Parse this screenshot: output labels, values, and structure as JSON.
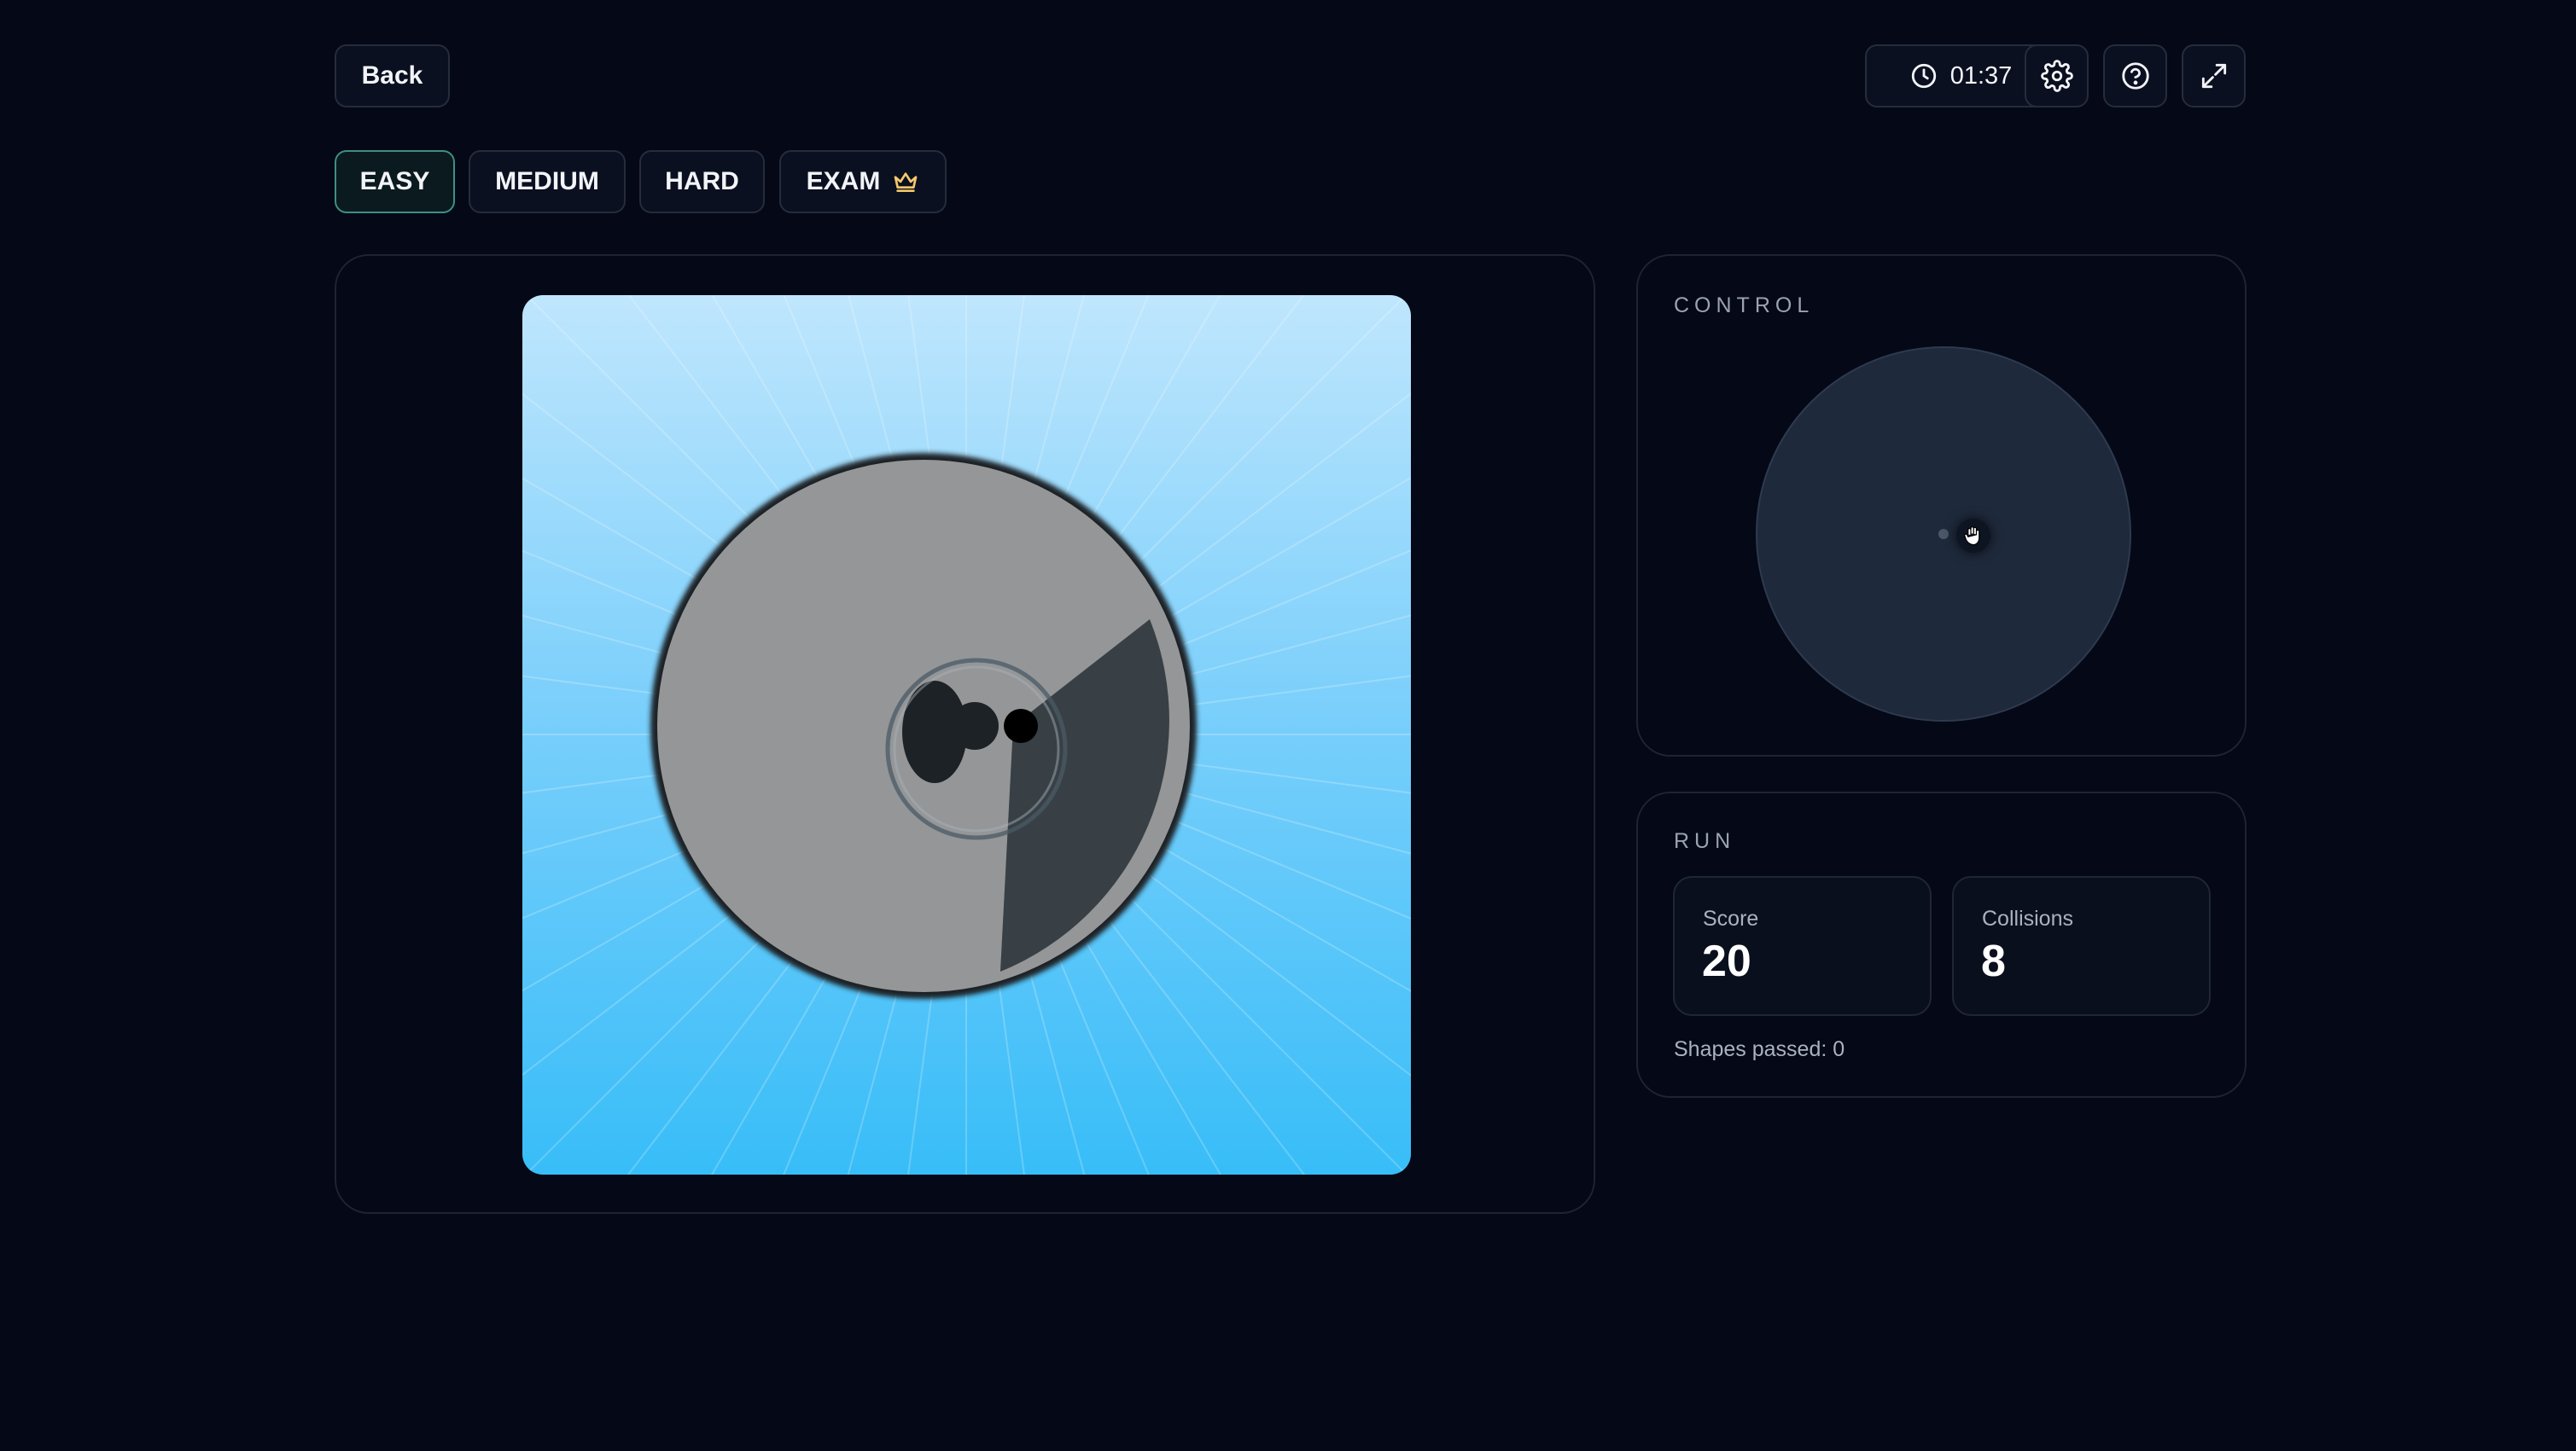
{
  "header": {
    "back_label": "Back",
    "timer": "01:37"
  },
  "difficulty": {
    "selected": "EASY",
    "options": [
      {
        "label": "EASY"
      },
      {
        "label": "MEDIUM"
      },
      {
        "label": "HARD"
      },
      {
        "label": "EXAM",
        "icon": "crown-icon"
      }
    ]
  },
  "control": {
    "title": "CONTROL"
  },
  "run": {
    "title": "RUN",
    "score_label": "Score",
    "score_value": "20",
    "collisions_label": "Collisions",
    "collisions_value": "8",
    "shapes_passed": "Shapes passed: 0"
  },
  "colors": {
    "background": "#050816",
    "accent_border": "#3f8f83",
    "sky_top": "#bfe6fd",
    "sky_bottom": "#38bdf8",
    "crown": "#f5c96b"
  }
}
